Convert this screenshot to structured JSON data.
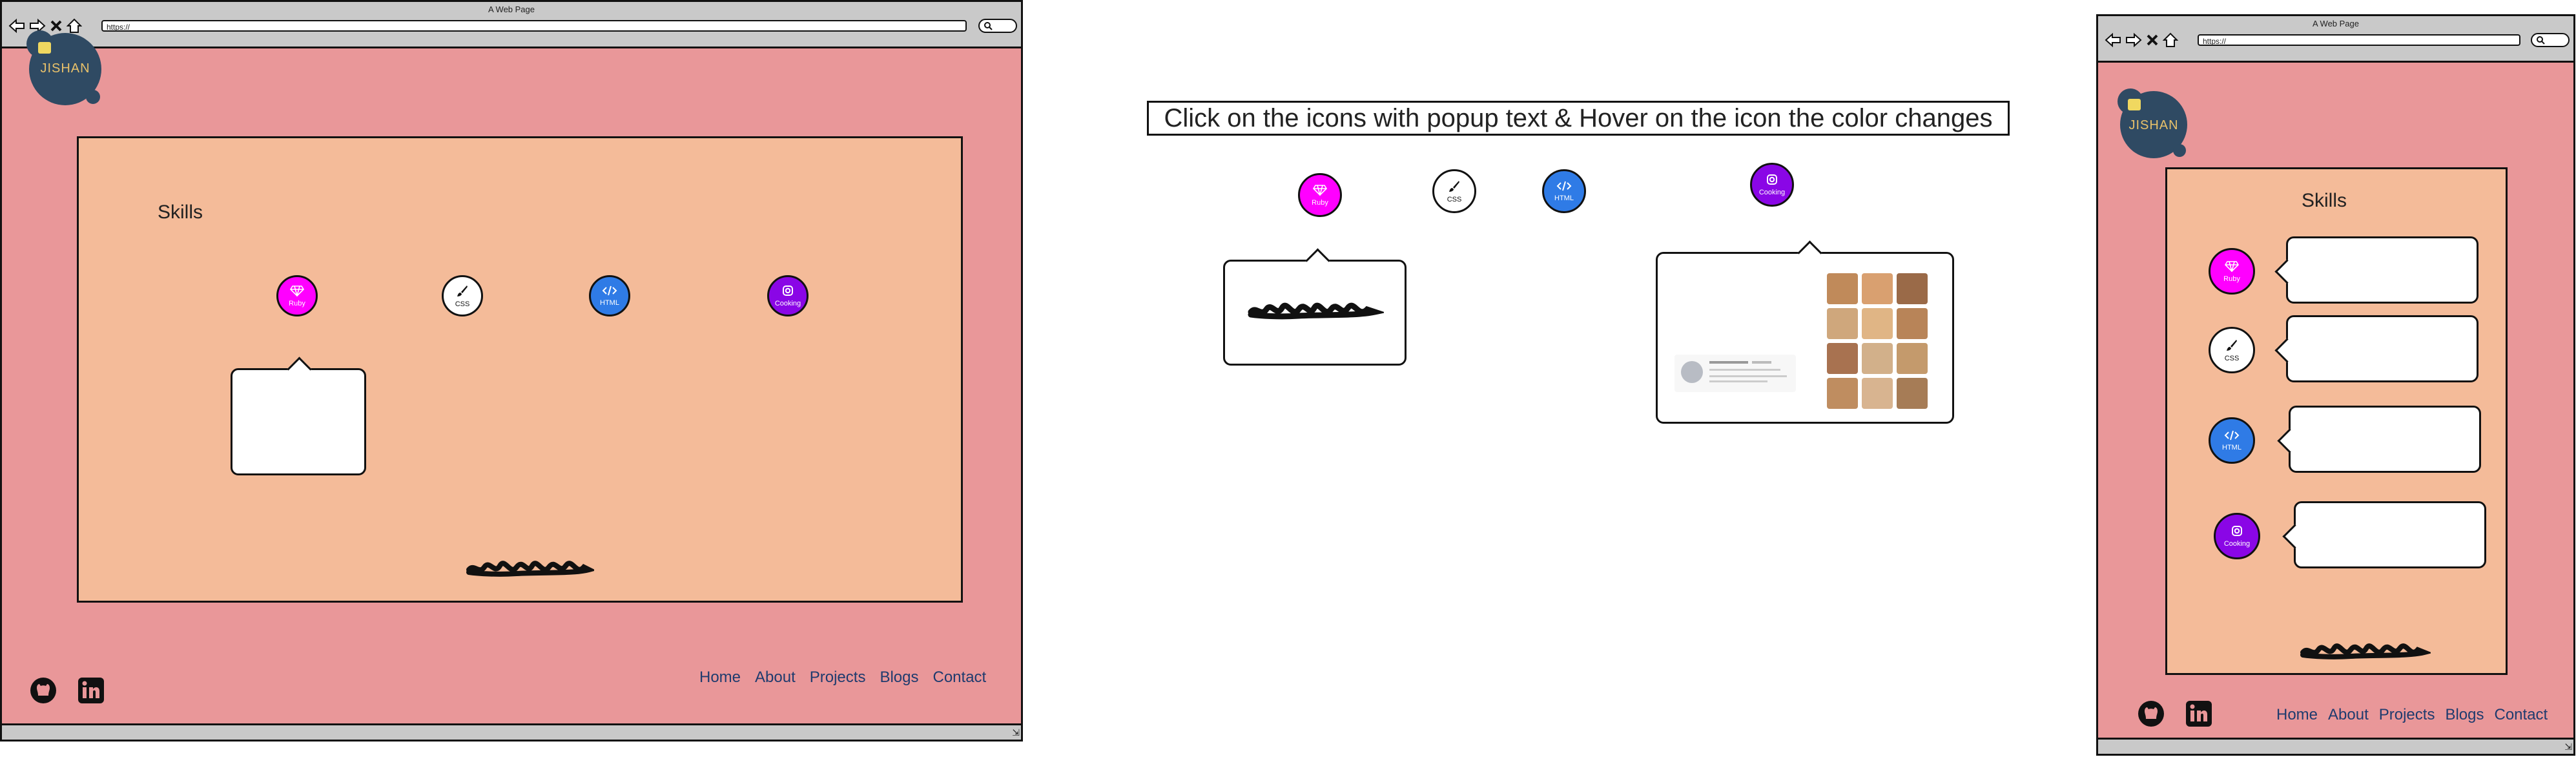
{
  "browser": {
    "title": "A Web Page",
    "url": "https://"
  },
  "logo": {
    "text": "JISHAN"
  },
  "skills_heading": "Skills",
  "skills": [
    {
      "label": "Ruby",
      "color": "#ff00ff",
      "icon": "gem-icon"
    },
    {
      "label": "CSS",
      "color": "#ffffff",
      "icon": "brush-icon"
    },
    {
      "label": "HTML",
      "color": "#2f7be6",
      "icon": "code-icon"
    },
    {
      "label": "Cooking",
      "color": "#8a06e6",
      "icon": "instagram-icon"
    }
  ],
  "instruction": "Click on the icons with popup text &  Hover on the icon the color changes",
  "nav": [
    "Home",
    "About",
    "Projects",
    "Blogs",
    "Contact"
  ],
  "social": [
    "github-icon",
    "linkedin-icon"
  ],
  "colors": {
    "page_bg": "#e99799",
    "panel_bg": "#f4bb99",
    "logo_bg": "#2f4a63",
    "nav_text": "#1f3b6e"
  }
}
